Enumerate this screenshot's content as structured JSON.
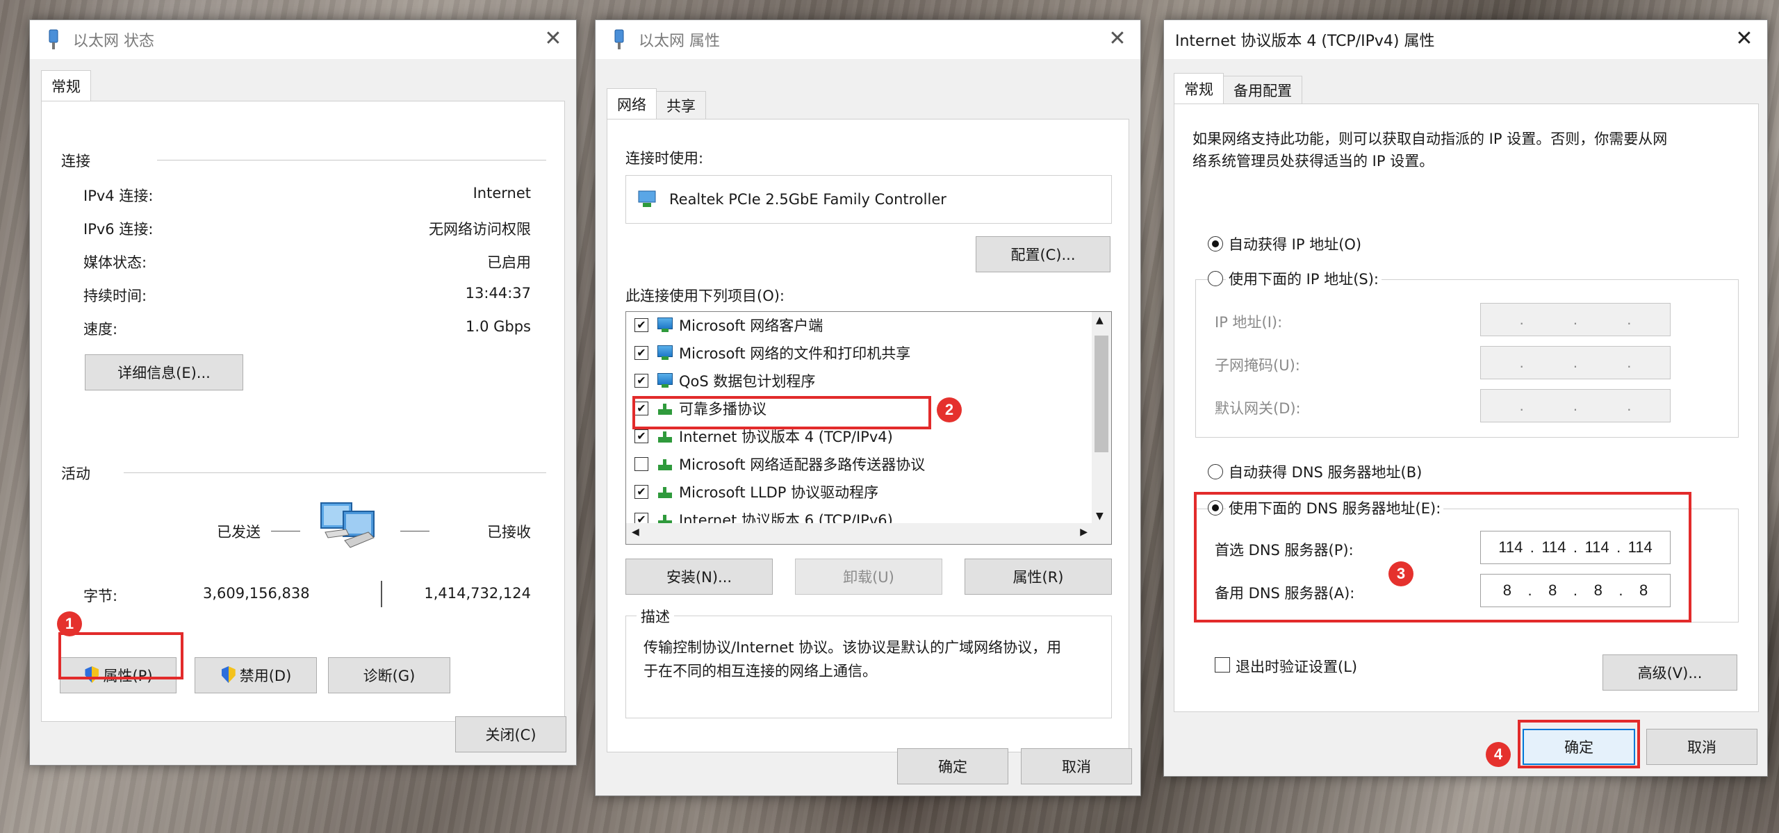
{
  "win1": {
    "title": "以太网 状态",
    "tab_general": "常规",
    "section_connection": "连接",
    "rows": [
      {
        "label": "IPv4 连接:",
        "value": "Internet"
      },
      {
        "label": "IPv6 连接:",
        "value": "无网络访问权限"
      },
      {
        "label": "媒体状态:",
        "value": "已启用"
      },
      {
        "label": "持续时间:",
        "value": "13:44:37"
      },
      {
        "label": "速度:",
        "value": "1.0 Gbps"
      }
    ],
    "details_button": "详细信息(E)...",
    "section_activity": "活动",
    "sent_label": "已发送",
    "received_label": "已接收",
    "bytes_label": "字节:",
    "bytes_sent": "3,609,156,838",
    "bytes_received": "1,414,732,124",
    "properties_button": "属性(P)",
    "disable_button": "禁用(D)",
    "diagnose_button": "诊断(G)",
    "close_button": "关闭(C)",
    "badge": "1"
  },
  "win2": {
    "title": "以太网 属性",
    "tab_network": "网络",
    "tab_sharing": "共享",
    "connect_using_label": "连接时使用:",
    "adapter_name": "Realtek PCIe 2.5GbE Family Controller",
    "configure_button": "配置(C)...",
    "items_label": "此连接使用下列项目(O):",
    "items": [
      {
        "label": "Microsoft 网络客户端",
        "checked": true,
        "icon": "network-client-icon"
      },
      {
        "label": "Microsoft 网络的文件和打印机共享",
        "checked": true,
        "icon": "network-client-icon"
      },
      {
        "label": "QoS 数据包计划程序",
        "checked": true,
        "icon": "network-client-icon"
      },
      {
        "label": "可靠多播协议",
        "checked": true,
        "icon": "protocol-icon"
      },
      {
        "label": "Internet 协议版本 4 (TCP/IPv4)",
        "checked": true,
        "icon": "protocol-icon"
      },
      {
        "label": "Microsoft 网络适配器多路传送器协议",
        "checked": false,
        "icon": "protocol-icon"
      },
      {
        "label": "Microsoft LLDP 协议驱动程序",
        "checked": true,
        "icon": "protocol-icon"
      },
      {
        "label": "Internet 协议版本 6 (TCP/IPv6)",
        "checked": true,
        "icon": "protocol-icon"
      }
    ],
    "install_button": "安装(N)...",
    "uninstall_button": "卸载(U)",
    "properties_button": "属性(R)",
    "description_label": "描述",
    "description_text_1": "传输控制协议/Internet 协议。该协议是默认的广域网络协议，用",
    "description_text_2": "于在不同的相互连接的网络上通信。",
    "ok_button": "确定",
    "cancel_button": "取消",
    "badge": "2"
  },
  "win3": {
    "title": "Internet 协议版本 4 (TCP/IPv4) 属性",
    "tab_general": "常规",
    "tab_alternate": "备用配置",
    "intro_line_1": "如果网络支持此功能，则可以获取自动指派的 IP 设置。否则，你需要从网",
    "intro_line_2": "络系统管理员处获得适当的 IP 设置。",
    "auto_ip": "自动获得 IP 地址(O)",
    "manual_ip": "使用下面的 IP 地址(S):",
    "ip_address_label": "IP 地址(I):",
    "subnet_label": "子网掩码(U):",
    "gateway_label": "默认网关(D):",
    "auto_dns": "自动获得 DNS 服务器地址(B)",
    "manual_dns": "使用下面的 DNS 服务器地址(E):",
    "preferred_dns_label": "首选 DNS 服务器(P):",
    "alternate_dns_label": "备用 DNS 服务器(A):",
    "preferred_dns": [
      "114",
      "114",
      "114",
      "114"
    ],
    "alternate_dns": [
      "8",
      "8",
      "8",
      "8"
    ],
    "validate_label": "退出时验证设置(L)",
    "advanced_button": "高级(V)...",
    "ok_button": "确定",
    "cancel_button": "取消",
    "badge_3": "3",
    "badge_4": "4"
  }
}
